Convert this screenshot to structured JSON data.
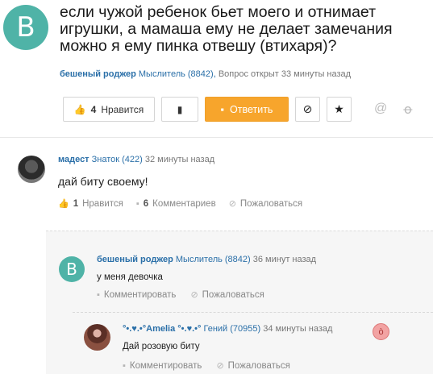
{
  "question": {
    "avatar_letter": "В",
    "title": "если чужой ребенок бьет моего и отнимает игрушки, а мамаша ему не делает замечания можно я ему пинка отвешу (втихаря)?",
    "author": "бешеный роджер",
    "rank": "Мыслитель (8842),",
    "status": "Вопрос открыт 33 минуты назад"
  },
  "actions": {
    "like_count": "4",
    "like_label": "Нравится",
    "answer_label": "Ответить"
  },
  "comments": [
    {
      "author": "мадест",
      "rank": "Знаток (422)",
      "time": "32 минуты назад",
      "text": "дай биту своему!",
      "like_count": "1",
      "like_label": "Нравится",
      "comments_count": "6",
      "comments_label": "Комментариев",
      "report_label": "Пожаловаться"
    },
    {
      "avatar_letter": "В",
      "author": "бешеный роджер",
      "rank": "Мыслитель (8842)",
      "time": "36 минут назад",
      "text": "у меня девочка",
      "comment_label": "Комментировать",
      "report_label": "Пожаловаться"
    },
    {
      "author": "°•.♥.•°Amelia °•.♥.•°",
      "rank": "Гений (70955)",
      "time": "34 минуты назад",
      "text": "Дай розовую биту",
      "comment_label": "Комментировать",
      "report_label": "Пожаловаться"
    }
  ],
  "icons": {
    "like": "thumbs-up-icon",
    "bookmark": "bookmark-icon",
    "answer": "speech-bubble-icon",
    "block": "block-icon",
    "star": "star-icon",
    "share_mail": "at-sign-icon",
    "share_ok": "odnoklassniki-icon",
    "comment": "comment-icon",
    "report": "report-icon",
    "emoji": "angry-face-icon"
  },
  "colors": {
    "accent_orange": "#f7a52c",
    "avatar_teal": "#4fb3a7",
    "link_blue": "#2a6fa8"
  }
}
